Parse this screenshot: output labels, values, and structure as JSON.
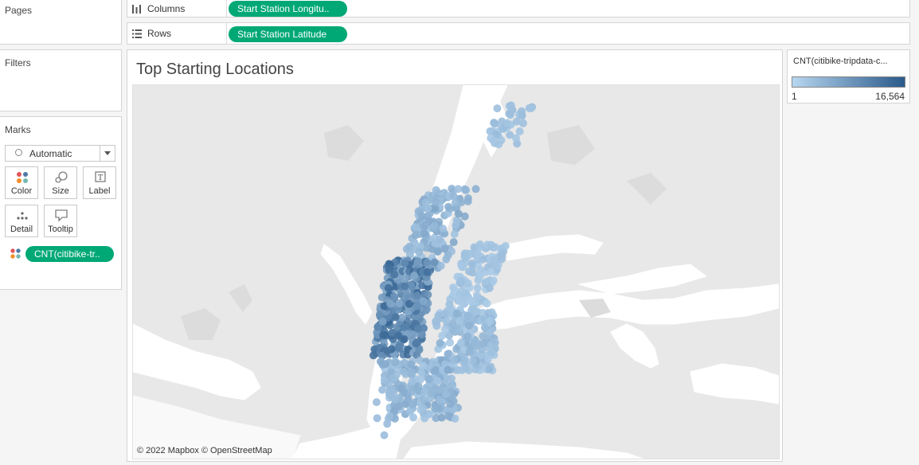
{
  "pages_card": {
    "title": "Pages"
  },
  "filters_card": {
    "title": "Filters"
  },
  "marks_card": {
    "title": "Marks",
    "mark_type": "Automatic",
    "buttons": [
      {
        "label": "Color",
        "icon": "color-icon"
      },
      {
        "label": "Size",
        "icon": "size-icon"
      },
      {
        "label": "Label",
        "icon": "label-icon"
      },
      {
        "label": "Detail",
        "icon": "detail-icon"
      },
      {
        "label": "Tooltip",
        "icon": "tooltip-icon"
      }
    ],
    "color_pill": "CNT(citibike-tr.."
  },
  "columns_shelf": {
    "label": "Columns",
    "pill": "Start Station Longitu.."
  },
  "rows_shelf": {
    "label": "Rows",
    "pill": "Start Station Latitude"
  },
  "view": {
    "title": "Top Starting Locations",
    "attribution": "© 2022 Mapbox © OpenStreetMap"
  },
  "legend": {
    "title": "CNT(citibike-tripdata-c...",
    "min_label": "1",
    "max_label": "16,564",
    "color_low": "#b7d6f0",
    "color_high": "#2a5a8a"
  },
  "colors": {
    "pill": "#00a876",
    "map_land": "#e8e8e8",
    "map_water": "#ffffff"
  }
}
